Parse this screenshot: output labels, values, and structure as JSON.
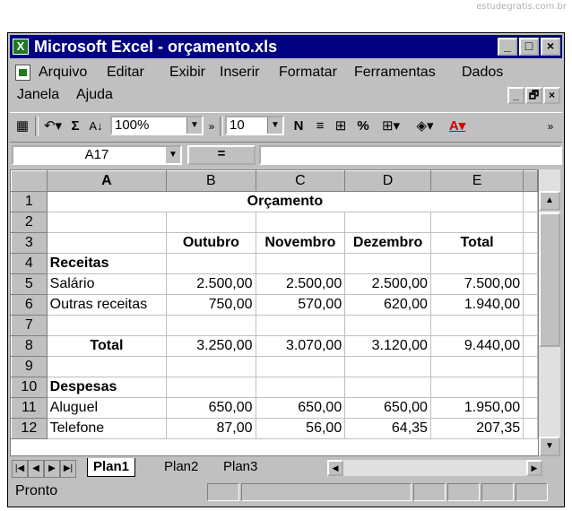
{
  "watermark": "estudegratis.com.br",
  "window": {
    "title": "Microsoft Excel - orçamento.xls",
    "icon": "excel-icon",
    "controls": [
      "_",
      "□",
      "×"
    ]
  },
  "menu": {
    "row1": [
      "Arquivo",
      "Editar",
      "Exibir",
      "Inserir",
      "Formatar",
      "Ferramentas",
      "Dados"
    ],
    "row2": [
      "Janela",
      "Ajuda"
    ],
    "mdi_controls": [
      "_",
      "🗗",
      "×"
    ]
  },
  "toolbar": {
    "zoom": "100%",
    "font_size": "10",
    "bold": "N",
    "percent": "%",
    "sigma": "Σ",
    "sort": "A↓",
    "more": "»",
    "font_color_letter": "A"
  },
  "formula_bar": {
    "cell_ref": "A17",
    "equals": "=",
    "content": ""
  },
  "grid": {
    "columns": [
      "A",
      "B",
      "C",
      "D",
      "E"
    ],
    "selected_column": "A",
    "title": "Orçamento",
    "headers": [
      "Outubro",
      "Novembro",
      "Dezembro",
      "Total"
    ],
    "rows": [
      {
        "n": "1"
      },
      {
        "n": "2"
      },
      {
        "n": "3"
      },
      {
        "n": "4",
        "label": "Receitas"
      },
      {
        "n": "5",
        "label": "Salário",
        "values": [
          "2.500,00",
          "2.500,00",
          "2.500,00",
          "7.500,00"
        ]
      },
      {
        "n": "6",
        "label": "Outras receitas",
        "values": [
          "750,00",
          "570,00",
          "620,00",
          "1.940,00"
        ]
      },
      {
        "n": "7"
      },
      {
        "n": "8",
        "label": "Total",
        "values": [
          "3.250,00",
          "3.070,00",
          "3.120,00",
          "9.440,00"
        ]
      },
      {
        "n": "9"
      },
      {
        "n": "10",
        "label": "Despesas"
      },
      {
        "n": "11",
        "label": "Aluguel",
        "values": [
          "650,00",
          "650,00",
          "650,00",
          "1.950,00"
        ]
      },
      {
        "n": "12",
        "label": "Telefone",
        "values": [
          "87,00",
          "56,00",
          "64,35",
          "207,35"
        ]
      }
    ]
  },
  "sheets": [
    "Plan1",
    "Plan2",
    "Plan3"
  ],
  "active_sheet": "Plan1",
  "status": "Pronto"
}
